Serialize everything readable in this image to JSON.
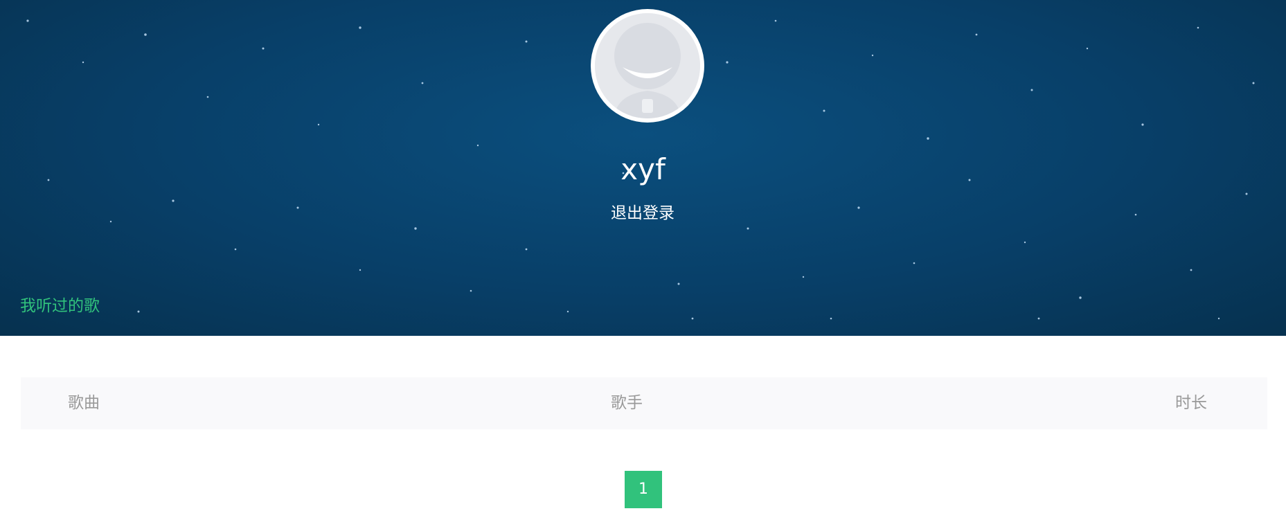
{
  "profile": {
    "username": "xyf",
    "logout_label": "退出登录"
  },
  "tabs": {
    "history_label": "我听过的歌"
  },
  "table": {
    "columns": [
      "歌曲",
      "歌手",
      "时长"
    ],
    "rows": []
  },
  "pagination": {
    "current_page": "1"
  },
  "colors": {
    "accent": "#31c27c",
    "banner": "#083f68",
    "header_text": "#999999"
  }
}
